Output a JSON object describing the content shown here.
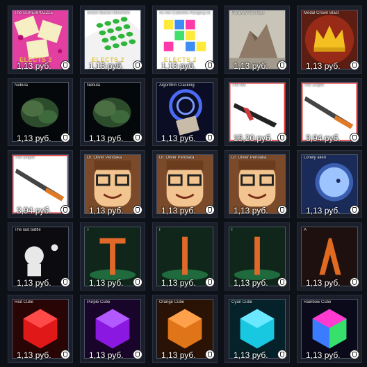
{
  "cards": [
    {
      "title": "The SUPERPUZZLE",
      "price": "1,13 руб.",
      "tag": "ELECTS 2",
      "art": "superpuzzle",
      "badge_icon": "steam-points-icon"
    },
    {
      "title": "Green Button Minefield",
      "price": "1,13 руб.",
      "tag": "ELECTS 2",
      "art": "minefield",
      "badge_icon": "steam-points-icon"
    },
    {
      "title": "As the Cubelets Hanging Out",
      "price": "1,13 руб.",
      "tag": "ELECTS 2",
      "art": "cubelets",
      "badge_icon": "steam-points-icon"
    },
    {
      "title": "Faraway Geology",
      "price": "1,13 руб.",
      "tag": "",
      "art": "geology",
      "badge_icon": "steam-points-icon"
    },
    {
      "title": "Medal Crown Blast",
      "price": "1,13 руб.",
      "tag": "",
      "art": "crown",
      "badge_icon": "steam-points-icon"
    },
    {
      "title": "Nebula",
      "price": "1,13 руб.",
      "tag": "",
      "art": "nebula",
      "badge_icon": "steam-points-icon"
    },
    {
      "title": "Nebula",
      "price": "1,13 руб.",
      "tag": "",
      "art": "nebula",
      "badge_icon": "steam-points-icon"
    },
    {
      "title": "Algorithm Cracking",
      "price": "1,13 руб.",
      "tag": "",
      "art": "algorithm",
      "badge_icon": "steam-points-icon"
    },
    {
      "title": "The M4",
      "price": "15,20 руб.",
      "tag": "",
      "art": "rifle",
      "badge_icon": "steam-points-icon"
    },
    {
      "title": "The Sniper",
      "price": "3,94 руб.",
      "tag": "",
      "art": "sniper",
      "badge_icon": "steam-points-icon"
    },
    {
      "title": "The Sniper",
      "price": "3,94 руб.",
      "tag": "",
      "art": "sniper",
      "badge_icon": "steam-points-icon"
    },
    {
      "title": "Dr. Oliver Pendaka",
      "price": "1,13 руб.",
      "tag": "",
      "art": "face",
      "badge_icon": "steam-points-icon"
    },
    {
      "title": "Dr. Oliver Pendaka",
      "price": "1,13 руб.",
      "tag": "",
      "art": "face",
      "badge_icon": "steam-points-icon"
    },
    {
      "title": "Dr. Oliver Pendaka",
      "price": "1,13 руб.",
      "tag": "",
      "art": "face",
      "badge_icon": "steam-points-icon"
    },
    {
      "title": "Lonely alien",
      "price": "1,13 руб.",
      "tag": "",
      "art": "alien",
      "badge_icon": "steam-points-icon"
    },
    {
      "title": "The last battle",
      "price": "1,13 руб.",
      "tag": "",
      "art": "astronaut",
      "badge_icon": "steam-points-icon"
    },
    {
      "title": "T",
      "price": "1,13 руб.",
      "tag": "",
      "art": "letter-t",
      "badge_icon": "steam-points-icon"
    },
    {
      "title": "I",
      "price": "1,13 руб.",
      "tag": "",
      "art": "letter-i",
      "badge_icon": "steam-points-icon"
    },
    {
      "title": "I",
      "price": "1,13 руб.",
      "tag": "",
      "art": "letter-i",
      "badge_icon": "steam-points-icon"
    },
    {
      "title": "A",
      "price": "1,13 руб.",
      "tag": "",
      "art": "letter-a",
      "badge_icon": "steam-points-icon"
    },
    {
      "title": "Red Cube",
      "price": "1,13 руб.",
      "tag": "",
      "art": "cube-red",
      "badge_icon": "steam-points-icon"
    },
    {
      "title": "Purple Cube",
      "price": "1,13 руб.",
      "tag": "",
      "art": "cube-purple",
      "badge_icon": "steam-points-icon"
    },
    {
      "title": "Orange Cube",
      "price": "1,13 руб.",
      "tag": "",
      "art": "cube-orange",
      "badge_icon": "steam-points-icon"
    },
    {
      "title": "Cyan Cube",
      "price": "1,13 руб.",
      "tag": "",
      "art": "cube-cyan",
      "badge_icon": "steam-points-icon"
    },
    {
      "title": "Rainbow Cube",
      "price": "1,13 руб.",
      "tag": "",
      "art": "cube-rainbow",
      "badge_icon": "steam-points-icon"
    }
  ]
}
